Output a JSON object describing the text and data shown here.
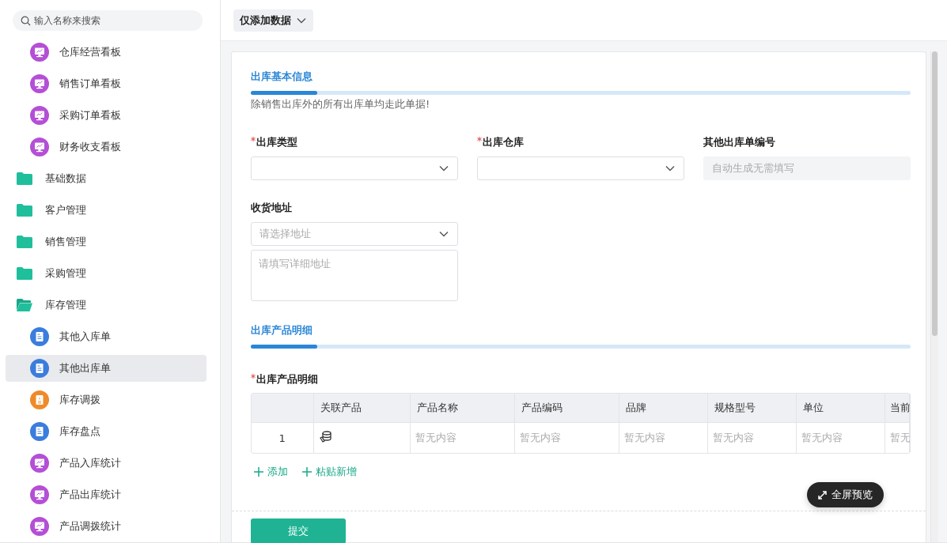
{
  "sidebar": {
    "search": {
      "placeholder": "输入名称来搜索"
    },
    "items": [
      {
        "kind": "dashboard",
        "label": "仓库经营看板",
        "selected": false
      },
      {
        "kind": "dashboard",
        "label": "销售订单看板",
        "selected": false
      },
      {
        "kind": "dashboard",
        "label": "采购订单看板",
        "selected": false
      },
      {
        "kind": "dashboard",
        "label": "财务收支看板",
        "selected": false
      },
      {
        "kind": "folder",
        "label": "基础数据",
        "expanded": false,
        "selected": false
      },
      {
        "kind": "folder",
        "label": "客户管理",
        "expanded": false,
        "selected": false
      },
      {
        "kind": "folder",
        "label": "销售管理",
        "expanded": false,
        "selected": false
      },
      {
        "kind": "folder",
        "label": "采购管理",
        "expanded": false,
        "selected": false
      },
      {
        "kind": "folder",
        "label": "库存管理",
        "expanded": true,
        "selected": false,
        "children": [
          {
            "kind": "document",
            "label": "其他入库单",
            "selected": false
          },
          {
            "kind": "document",
            "label": "其他出库单",
            "selected": true
          },
          {
            "kind": "transfer",
            "label": "库存调拨",
            "selected": false
          },
          {
            "kind": "document",
            "label": "库存盘点",
            "selected": false
          },
          {
            "kind": "dashboard",
            "label": "产品入库统计",
            "selected": false
          },
          {
            "kind": "dashboard",
            "label": "产品出库统计",
            "selected": false
          },
          {
            "kind": "dashboard",
            "label": "产品调拨统计",
            "selected": false
          }
        ]
      }
    ]
  },
  "toolbar": {
    "mode_dropdown": "仅添加数据"
  },
  "form": {
    "section_basic": {
      "title": "出库基本信息",
      "description": "除销售出库外的所有出库单均走此单据!"
    },
    "fields": [
      {
        "kind": "select",
        "label": "出库类型",
        "required": true
      },
      {
        "kind": "select",
        "label": "出库仓库",
        "required": true
      },
      {
        "kind": "readonly",
        "label": "其他出库单编号",
        "required": false,
        "placeholder": "自动生成无需填写"
      }
    ],
    "address": {
      "label": "收货地址",
      "select_placeholder": "请选择地址",
      "detail_placeholder": "请填写详细地址"
    },
    "section_products": {
      "title": "出库产品明细"
    },
    "table": {
      "label": "出库产品明细",
      "required": true,
      "columns": [
        "",
        "关联产品",
        "产品名称",
        "产品编码",
        "品牌",
        "规格型号",
        "单位",
        "当前"
      ],
      "rows": [
        [
          "1",
          "",
          "暂无内容",
          "暂无内容",
          "暂无内容",
          "暂无内容",
          "暂无内容",
          "暂无"
        ]
      ]
    },
    "table_actions": [
      "添加",
      "粘贴新增"
    ],
    "submit": "提交"
  },
  "fullscreen_button": "全屏预览"
}
